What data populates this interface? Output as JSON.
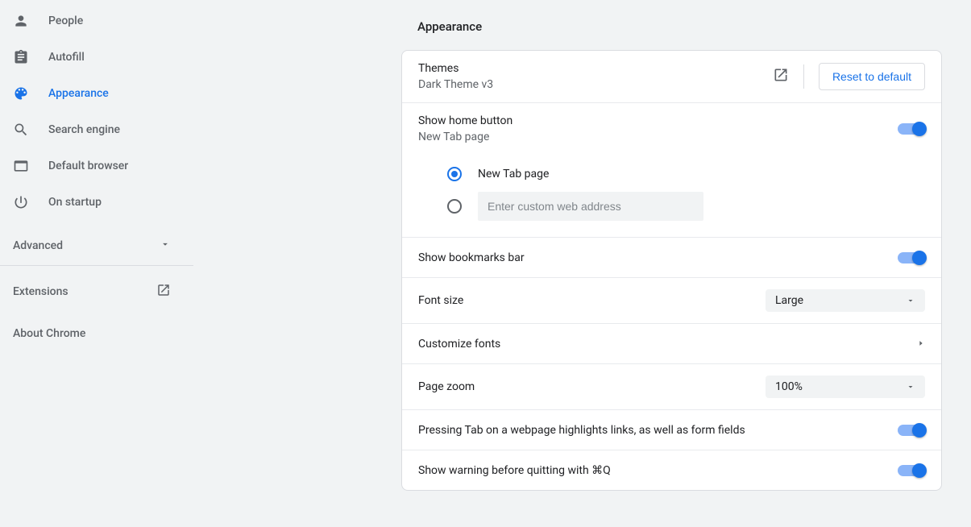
{
  "sidebar": {
    "items": [
      {
        "label": "People"
      },
      {
        "label": "Autofill"
      },
      {
        "label": "Appearance"
      },
      {
        "label": "Search engine"
      },
      {
        "label": "Default browser"
      },
      {
        "label": "On startup"
      }
    ],
    "advanced_label": "Advanced",
    "extensions_label": "Extensions",
    "about_label": "About Chrome"
  },
  "main": {
    "title": "Appearance",
    "themes": {
      "title": "Themes",
      "sub": "Dark Theme v3",
      "reset_label": "Reset to default"
    },
    "home_button": {
      "title": "Show home button",
      "sub": "New Tab page",
      "option_newtab": "New Tab page",
      "option_custom_placeholder": "Enter custom web address"
    },
    "bookmarks_bar": "Show bookmarks bar",
    "font_size": {
      "title": "Font size",
      "value": "Large"
    },
    "customize_fonts": "Customize fonts",
    "page_zoom": {
      "title": "Page zoom",
      "value": "100%"
    },
    "tab_highlight": "Pressing Tab on a webpage highlights links, as well as form fields",
    "quit_warning": "Show warning before quitting with ⌘Q"
  }
}
